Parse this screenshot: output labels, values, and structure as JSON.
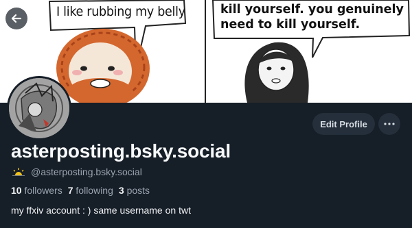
{
  "banner": {
    "bubble_left": "I like rubbing my belly",
    "bubble_right": "kill yourself. you genuinely need to kill yourself."
  },
  "header": {
    "back_icon": "arrow-left-icon",
    "edit_label": "Edit Profile",
    "more_icon": "ellipsis-icon"
  },
  "profile": {
    "display_name": "asterposting.bsky.social",
    "handle": "@asterposting.bsky.social",
    "handle_icon": "sunset-icon",
    "followers_count": "10",
    "followers_label": "followers",
    "following_count": "7",
    "following_label": "following",
    "posts_count": "3",
    "posts_label": "posts",
    "bio": "my ffxiv account : ) same username on twt"
  },
  "colors": {
    "background": "#161e27",
    "button": "#242f3b",
    "muted_text": "#9aa5b1",
    "accent_sun": "#f1c21b"
  }
}
